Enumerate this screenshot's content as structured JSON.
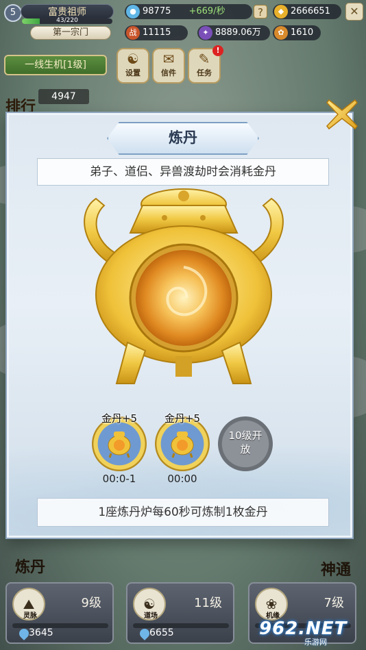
{
  "hud": {
    "level": "5",
    "title": "富贵祖师",
    "exp_text": "43/220",
    "exp_fraction": 0.195,
    "sect": "第一宗门",
    "spirit": "98775",
    "spirit_rate": "+669/秒",
    "plus_glyph": "?",
    "gold": "2666651",
    "power": "11115",
    "power_icon_text": "战",
    "cultivation": "8889.06万",
    "treasure": "1610",
    "close_glyph": "✕"
  },
  "left_panel": {
    "banner": "一线生机[1级]",
    "rank_number": "4947",
    "rank_label": "排行"
  },
  "menu": [
    {
      "label": "设置",
      "glyph": "☯",
      "badge": ""
    },
    {
      "label": "信件",
      "glyph": "✉",
      "badge": ""
    },
    {
      "label": "任务",
      "glyph": "✎",
      "badge": "!"
    }
  ],
  "dialog": {
    "title": "炼丹",
    "description": "弟子、道侣、异兽渡劫时会消耗金丹",
    "footer": "1座炼丹炉每60秒可炼制1枚金丹"
  },
  "slots": [
    {
      "badge": "金丹+5",
      "timer": "00:0-1",
      "locked": false
    },
    {
      "badge": "金丹+5",
      "timer": "00:00",
      "locked": false
    },
    {
      "badge": "",
      "lock_text": "10级开\n放",
      "timer": "",
      "locked": true
    }
  ],
  "side_labels": {
    "left": "炼丹",
    "right": "神通"
  },
  "bottom": [
    {
      "icon_label": "灵脉",
      "icon_glyph": "⛰",
      "level": "9级",
      "cost": "3645"
    },
    {
      "icon_label": "道场",
      "icon_glyph": "☯",
      "level": "11级",
      "cost": "6655"
    },
    {
      "icon_label": "机缘",
      "icon_glyph": "❀",
      "level": "7级",
      "cost": ""
    }
  ],
  "watermark": {
    "logo": "962.NET",
    "sub": "乐游网"
  },
  "colors": {
    "gold": "#e8c24a",
    "dialog_bg": "#e3ebf3",
    "accent_blue": "#7c9fc3",
    "rate_green": "#9fe37a"
  }
}
